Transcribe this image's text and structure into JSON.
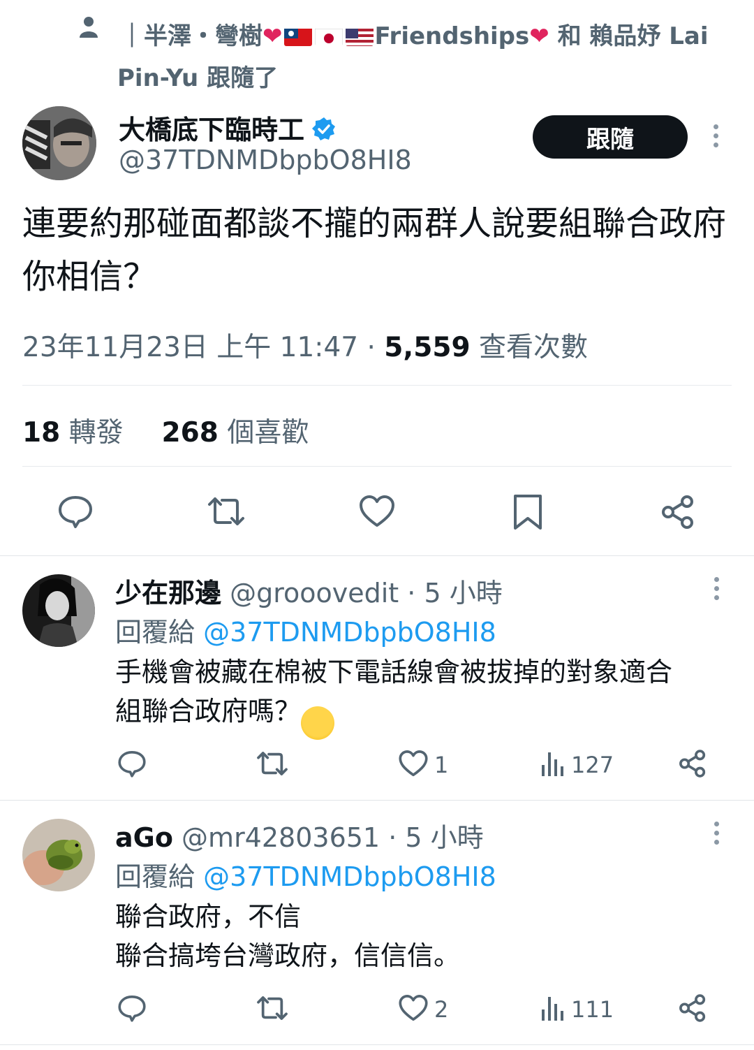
{
  "social_context": {
    "line1_prefix": "｜半澤・彎樹",
    "line1_suffix": "Friendships",
    "line1_tail": " 和 賴品妤 Lai",
    "line2": "Pin-Yu 跟隨了",
    "heart": "❤",
    "icon": "person-icon"
  },
  "main_tweet": {
    "author_name": "大橋底下臨時工",
    "handle": "@37TDNMDbpbO8HI8",
    "follow_label": "跟隨",
    "text": "連要約那碰面都談不攏的兩群人說要組聯合政府你相信？",
    "timestamp": "23年11月23日 上午 11:47",
    "separator": " · ",
    "views_count": "5,559",
    "views_label": " 查看次數",
    "retweets_count": "18",
    "retweets_label": " 轉發",
    "likes_count": "268",
    "likes_label": " 個喜歡"
  },
  "replies": [
    {
      "name": "少在那邊",
      "handle": "@grooovedit",
      "time": " · 5 小時",
      "reply_to_label": "回覆給 ",
      "reply_to_handle": "@37TDNMDbpbO8HI8",
      "text_line1": "手機會被藏在棉被下電話線會被拔掉的對象適合",
      "text_line2": "組聯合政府嗎？",
      "emoji": "🥹",
      "likes": "1",
      "views": "127"
    },
    {
      "name": "aGo",
      "handle": "@mr42803651",
      "time": " · 5 小時",
      "reply_to_label": "回覆給 ",
      "reply_to_handle": "@37TDNMDbpbO8HI8",
      "text_line1": "聯合政府，不信",
      "text_line2": "聯合搞垮台灣政府，信信信。",
      "likes": "2",
      "views": "111"
    }
  ],
  "colors": {
    "accent": "#1d9bf0",
    "text_primary": "#0f1419",
    "text_secondary": "#536471",
    "heart": "#e0245e"
  }
}
